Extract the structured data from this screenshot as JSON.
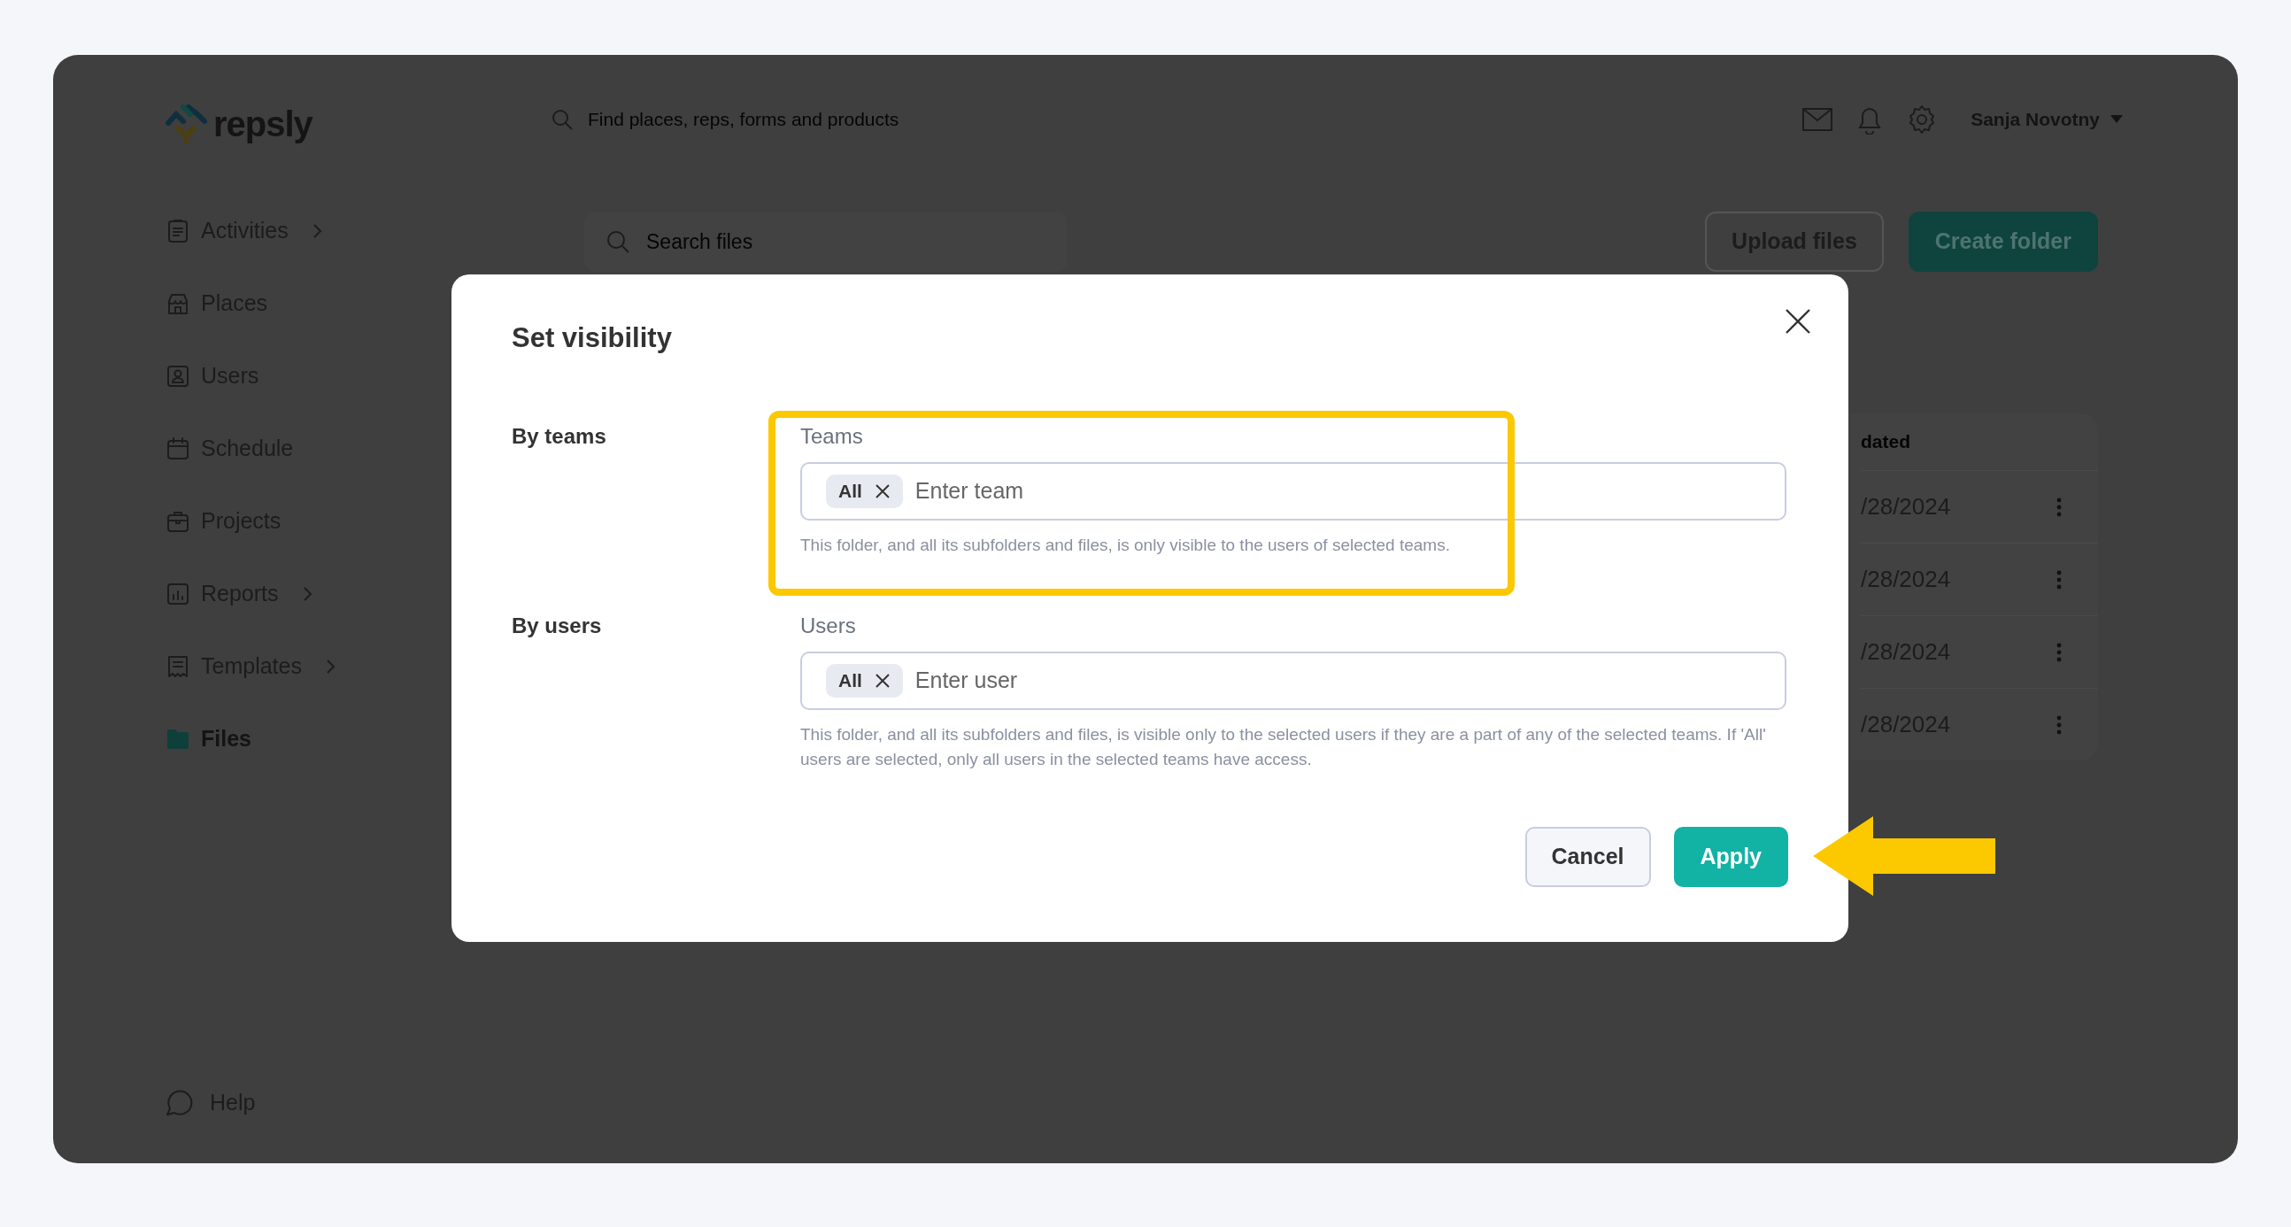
{
  "app": {
    "logo": "repsly",
    "search_placeholder": "Find places, reps, forms and products",
    "user_name": "Sanja Novotny"
  },
  "sidebar": {
    "items": [
      {
        "label": "Activities",
        "kind": "activities",
        "has_submenu": true,
        "selected": false
      },
      {
        "label": "Places",
        "kind": "places",
        "has_submenu": false,
        "selected": false
      },
      {
        "label": "Users",
        "kind": "users",
        "has_submenu": false,
        "selected": false
      },
      {
        "label": "Schedule",
        "kind": "schedule",
        "has_submenu": false,
        "selected": false
      },
      {
        "label": "Projects",
        "kind": "projects",
        "has_submenu": false,
        "selected": false
      },
      {
        "label": "Reports",
        "kind": "reports",
        "has_submenu": true,
        "selected": false
      },
      {
        "label": "Templates",
        "kind": "templates",
        "has_submenu": true,
        "selected": false
      },
      {
        "label": "Files",
        "kind": "files",
        "has_submenu": false,
        "selected": true
      }
    ],
    "help": "Help"
  },
  "toolbar": {
    "search_placeholder": "Search files",
    "buttons": [
      {
        "label": "Upload files",
        "kind": "secondary"
      },
      {
        "label": "Create folder",
        "kind": "primary"
      }
    ]
  },
  "table": {
    "column_header": "dated",
    "rows": [
      {
        "date": "/28/2024"
      },
      {
        "date": "/28/2024"
      },
      {
        "date": "/28/2024"
      },
      {
        "date": "/28/2024"
      }
    ]
  },
  "dialog": {
    "title": "Set visibility",
    "sections": [
      {
        "label": "By teams",
        "field_label": "Teams",
        "chips": [
          "All"
        ],
        "placeholder": "Enter team",
        "help": "This folder, and all its subfolders and files, is only visible to the users of selected teams.",
        "highlighted": true
      },
      {
        "label": "By users",
        "field_label": "Users",
        "chips": [
          "All"
        ],
        "placeholder": "Enter user",
        "help": "This folder, and all its subfolders and files, is visible only to the selected users if they are a part of any of the selected teams. If 'All' users are selected, only all users in the selected teams have access.",
        "highlighted": false
      }
    ],
    "buttons": [
      {
        "label": "Cancel",
        "kind": "secondary",
        "pointed": false
      },
      {
        "label": "Apply",
        "kind": "primary",
        "pointed": true
      }
    ]
  }
}
